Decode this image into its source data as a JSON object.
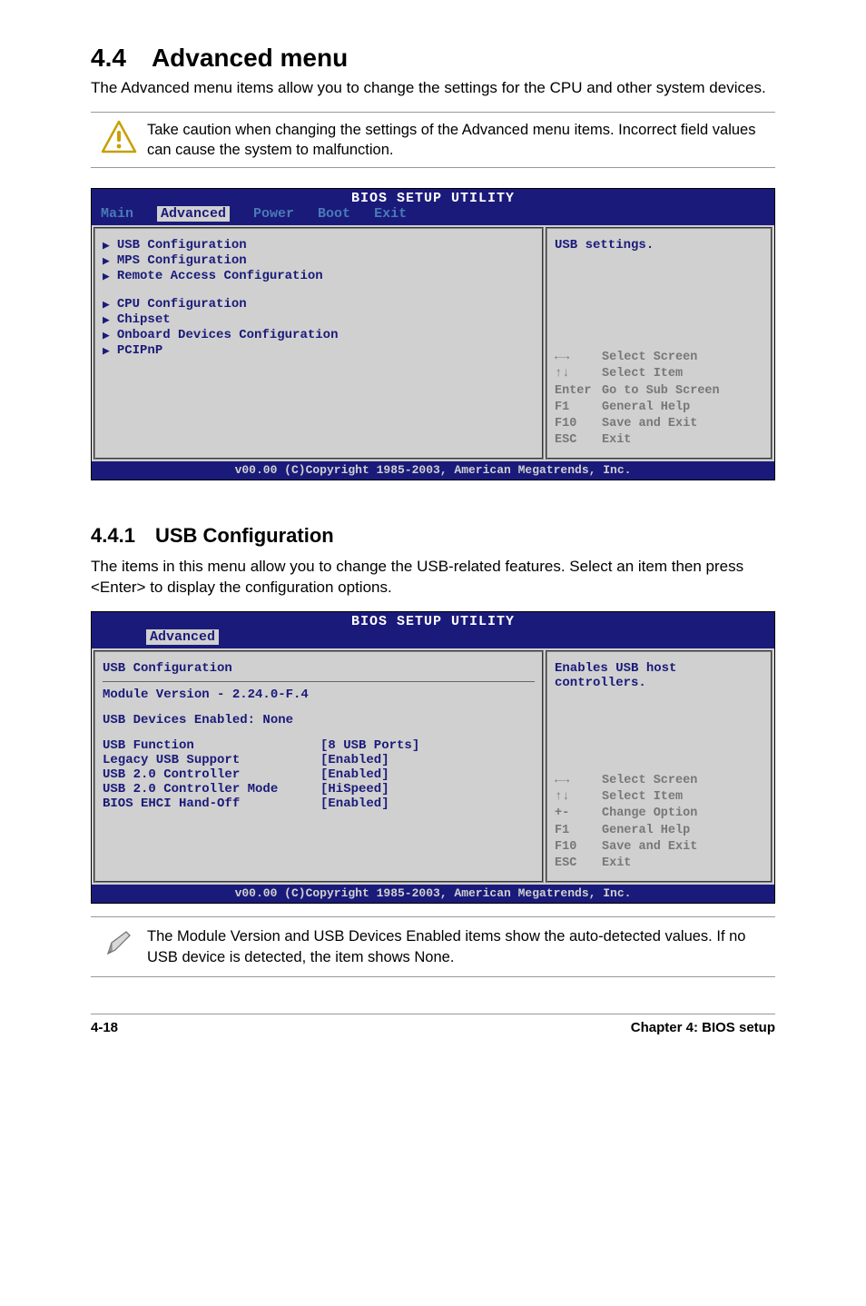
{
  "section": {
    "number": "4.4",
    "title": "Advanced menu"
  },
  "intro": "The Advanced menu items allow you to change the settings for the CPU and other system devices.",
  "caution": "Take caution when changing the settings of the Advanced menu items. Incorrect field values can cause the system to malfunction.",
  "bios_header": "BIOS SETUP UTILITY",
  "tabs": {
    "main": "Main",
    "advanced": "Advanced",
    "power": "Power",
    "boot": "Boot",
    "exit": "Exit"
  },
  "adv_menu": {
    "group1": [
      "USB Configuration",
      "MPS Configuration",
      "Remote Access Configuration"
    ],
    "group2": [
      "CPU Configuration",
      "Chipset",
      "Onboard Devices Configuration",
      "PCIPnP"
    ],
    "help": "USB settings."
  },
  "keys": [
    {
      "k": "←→",
      "d": "Select Screen"
    },
    {
      "k": "↑↓",
      "d": "Select Item"
    },
    {
      "k": "Enter",
      "d": "Go to Sub Screen"
    },
    {
      "k": "F1",
      "d": "General Help"
    },
    {
      "k": "F10",
      "d": "Save and Exit"
    },
    {
      "k": "ESC",
      "d": "Exit"
    }
  ],
  "keys2": [
    {
      "k": "←→",
      "d": "Select Screen"
    },
    {
      "k": "↑↓",
      "d": "Select Item"
    },
    {
      "k": "+-",
      "d": "Change Option"
    },
    {
      "k": "F1",
      "d": "General Help"
    },
    {
      "k": "F10",
      "d": "Save and Exit"
    },
    {
      "k": "ESC",
      "d": "Exit"
    }
  ],
  "copyright": "v00.00 (C)Copyright 1985-2003, American Megatrends, Inc.",
  "subsection": {
    "number": "4.4.1",
    "title": "USB Configuration"
  },
  "sub_intro": "The items in this menu allow you to change the USB-related features. Select an item then press <Enter> to display the configuration options.",
  "usb": {
    "title": "USB Configuration",
    "module": "Module Version - 2.24.0-F.4",
    "devices": "USB Devices Enabled: None",
    "rows": [
      {
        "lab": "USB Function",
        "val": "[8 USB Ports]"
      },
      {
        "lab": "Legacy USB Support",
        "val": "[Enabled]"
      },
      {
        "lab": "USB 2.0 Controller",
        "val": "[Enabled]"
      },
      {
        "lab": "USB 2.0 Controller Mode",
        "val": "[HiSpeed]"
      },
      {
        "lab": "BIOS EHCI Hand-Off",
        "val": "[Enabled]"
      }
    ],
    "help": "Enables USB host controllers."
  },
  "note2": "The Module Version and USB Devices Enabled items show the auto-detected values. If no USB device is detected, the item shows None.",
  "footer": {
    "left": "4-18",
    "right": "Chapter 4: BIOS setup"
  }
}
